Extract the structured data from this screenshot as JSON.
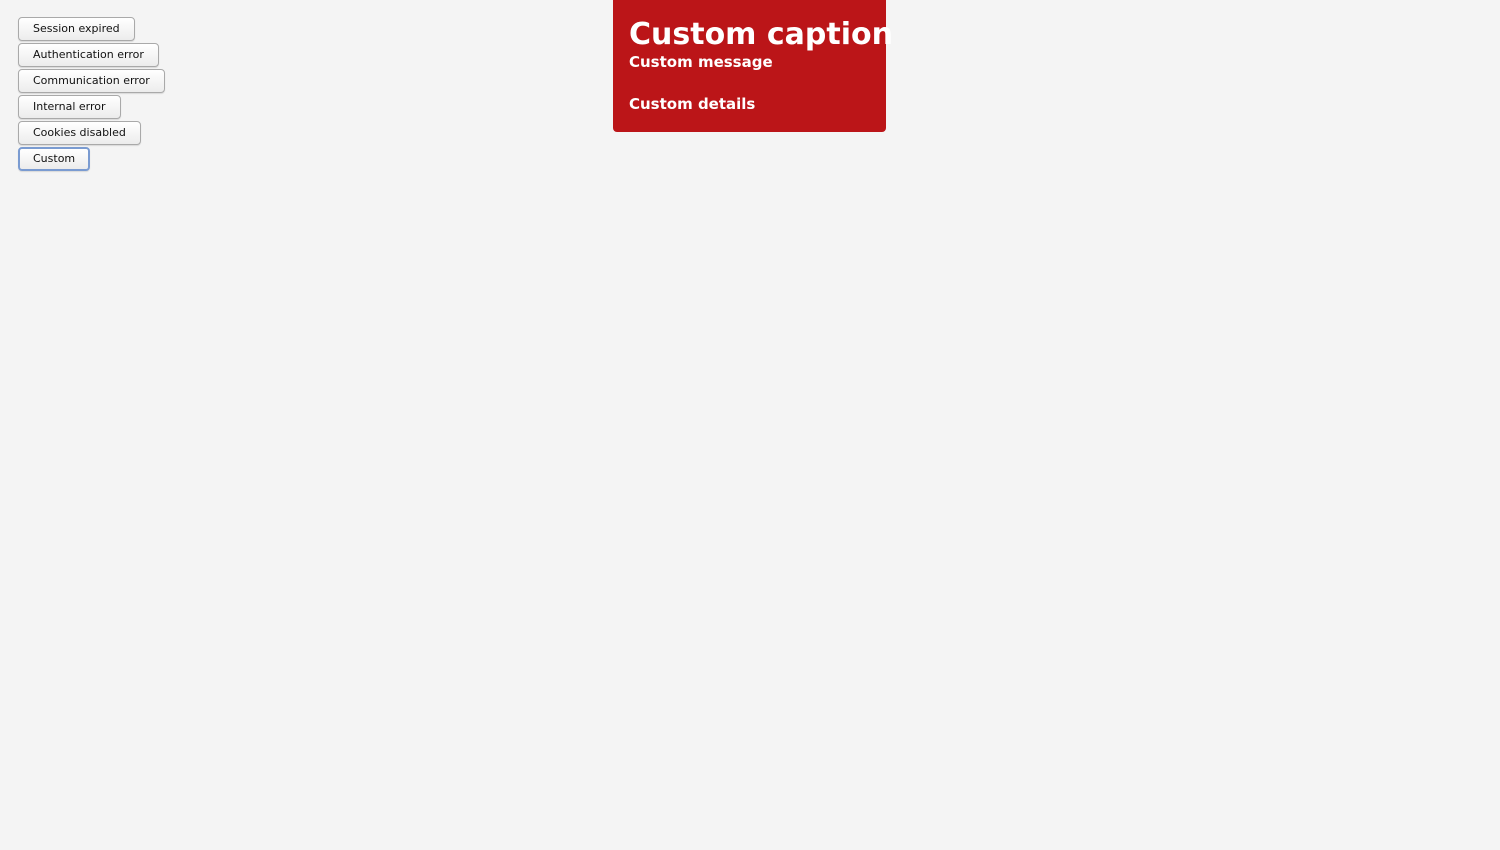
{
  "buttons": [
    {
      "label": "Session expired"
    },
    {
      "label": "Authentication error"
    },
    {
      "label": "Communication error"
    },
    {
      "label": "Internal error"
    },
    {
      "label": "Cookies disabled"
    },
    {
      "label": "Custom"
    }
  ],
  "notification": {
    "caption": "Custom caption",
    "message": "Custom message",
    "details": "Custom details",
    "background_color": "#bb1518",
    "text_color": "#ffffff"
  }
}
